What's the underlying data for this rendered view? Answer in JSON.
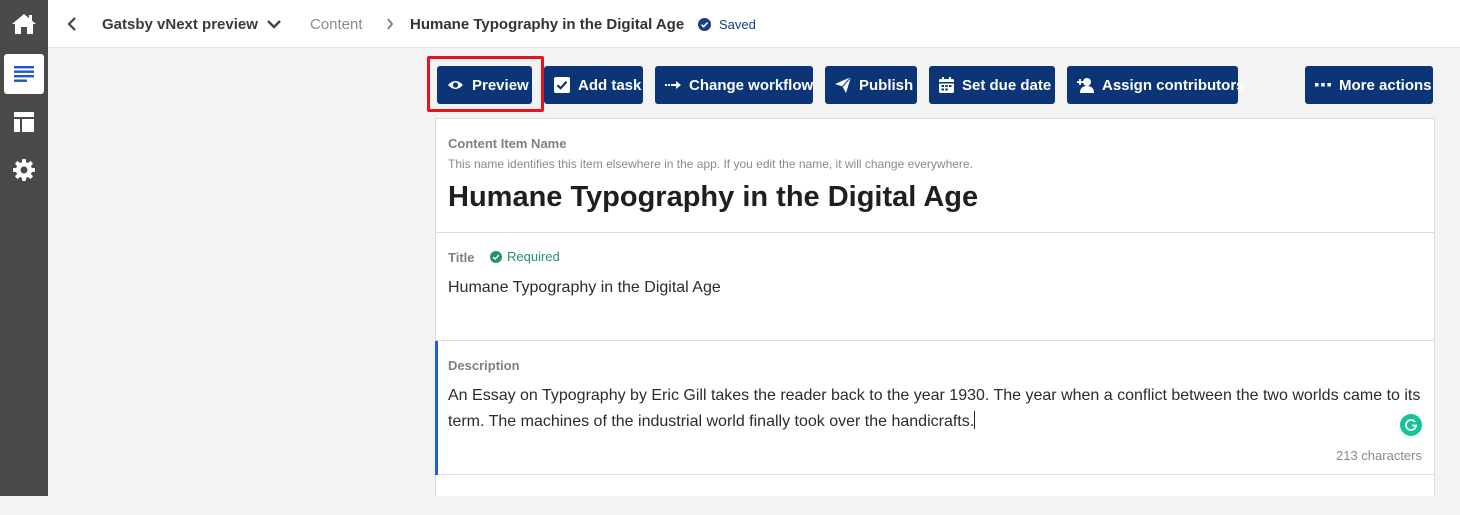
{
  "nav": {
    "items": [
      {
        "name": "home",
        "icon": "home-icon",
        "active": false
      },
      {
        "name": "content",
        "icon": "content-list-icon",
        "active": true
      },
      {
        "name": "layout",
        "icon": "layout-icon",
        "active": false
      },
      {
        "name": "settings",
        "icon": "gear-icon",
        "active": false
      }
    ]
  },
  "topbar": {
    "project_name": "Gatsby vNext preview",
    "breadcrumb_content": "Content",
    "breadcrumb_item": "Humane Typography in the Digital Age",
    "status": "Saved"
  },
  "toolbar": {
    "preview": "Preview",
    "add_task": "Add task",
    "change_workflow": "Change workflow",
    "publish": "Publish",
    "set_due_date": "Set due date",
    "assign_contributors": "Assign contributors",
    "more_actions": "More actions"
  },
  "form": {
    "item_name": {
      "label": "Content Item Name",
      "hint": "This name identifies this item elsewhere in the app. If you edit the name, it will change everywhere.",
      "value": "Humane Typography in the Digital Age"
    },
    "title": {
      "label": "Title",
      "required": "Required",
      "value": "Humane Typography in the Digital Age"
    },
    "description": {
      "label": "Description",
      "value": "An Essay on Typography by Eric Gill takes the reader back to the year 1930. The year when a conflict between the two worlds came to its term. The machines of the industrial world finally took over the handicrafts.",
      "counter": "213 characters"
    }
  },
  "colors": {
    "rail": "#4a4a4a",
    "button": "#0b3576",
    "required": "#22955f",
    "focus": "#1f5fd6",
    "highlight": "#e4151f"
  }
}
